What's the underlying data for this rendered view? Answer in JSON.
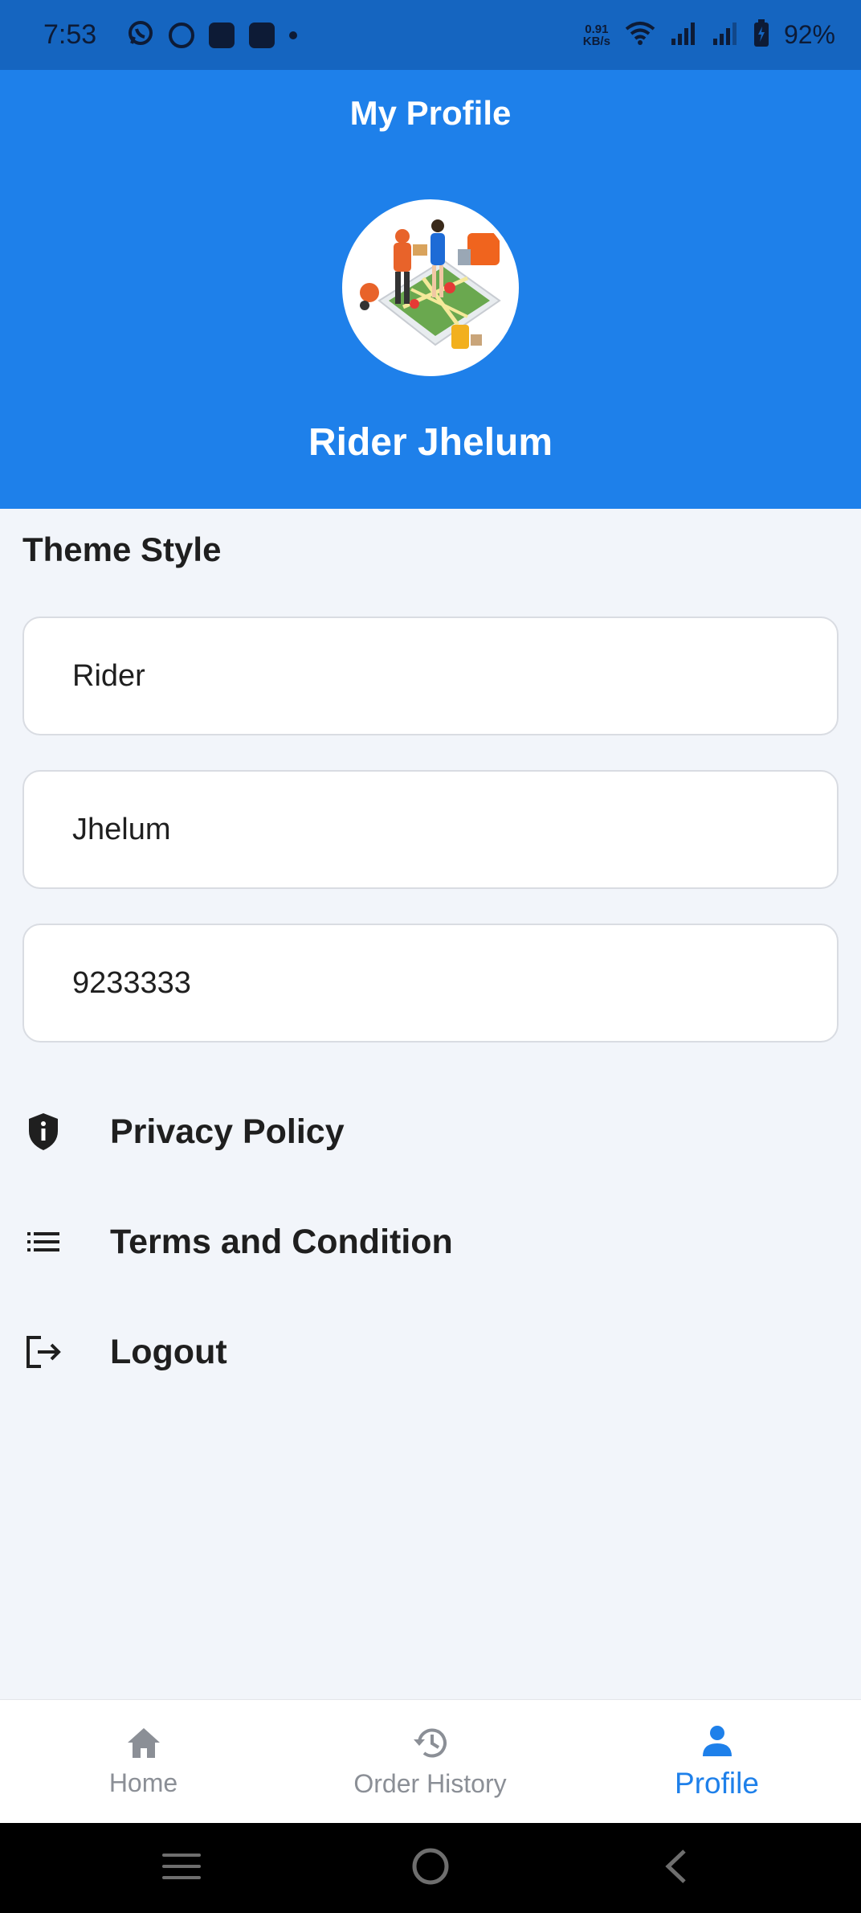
{
  "status_bar": {
    "time": "7:53",
    "speed_value": "0.91",
    "speed_unit": "KB/s",
    "battery": "92%"
  },
  "header": {
    "title": "My Profile",
    "name": "Rider Jhelum",
    "bg_color": "#1e80ea"
  },
  "section": {
    "title": "Theme Style"
  },
  "fields": {
    "first_name": "Rider",
    "last_name": "Jhelum",
    "phone": "9233333"
  },
  "menu": {
    "privacy": "Privacy Policy",
    "terms": "Terms and Condition",
    "logout": "Logout"
  },
  "bottom_nav": {
    "home": "Home",
    "order_history": "Order History",
    "profile": "Profile",
    "active": "profile",
    "active_color": "#1e80ea"
  }
}
